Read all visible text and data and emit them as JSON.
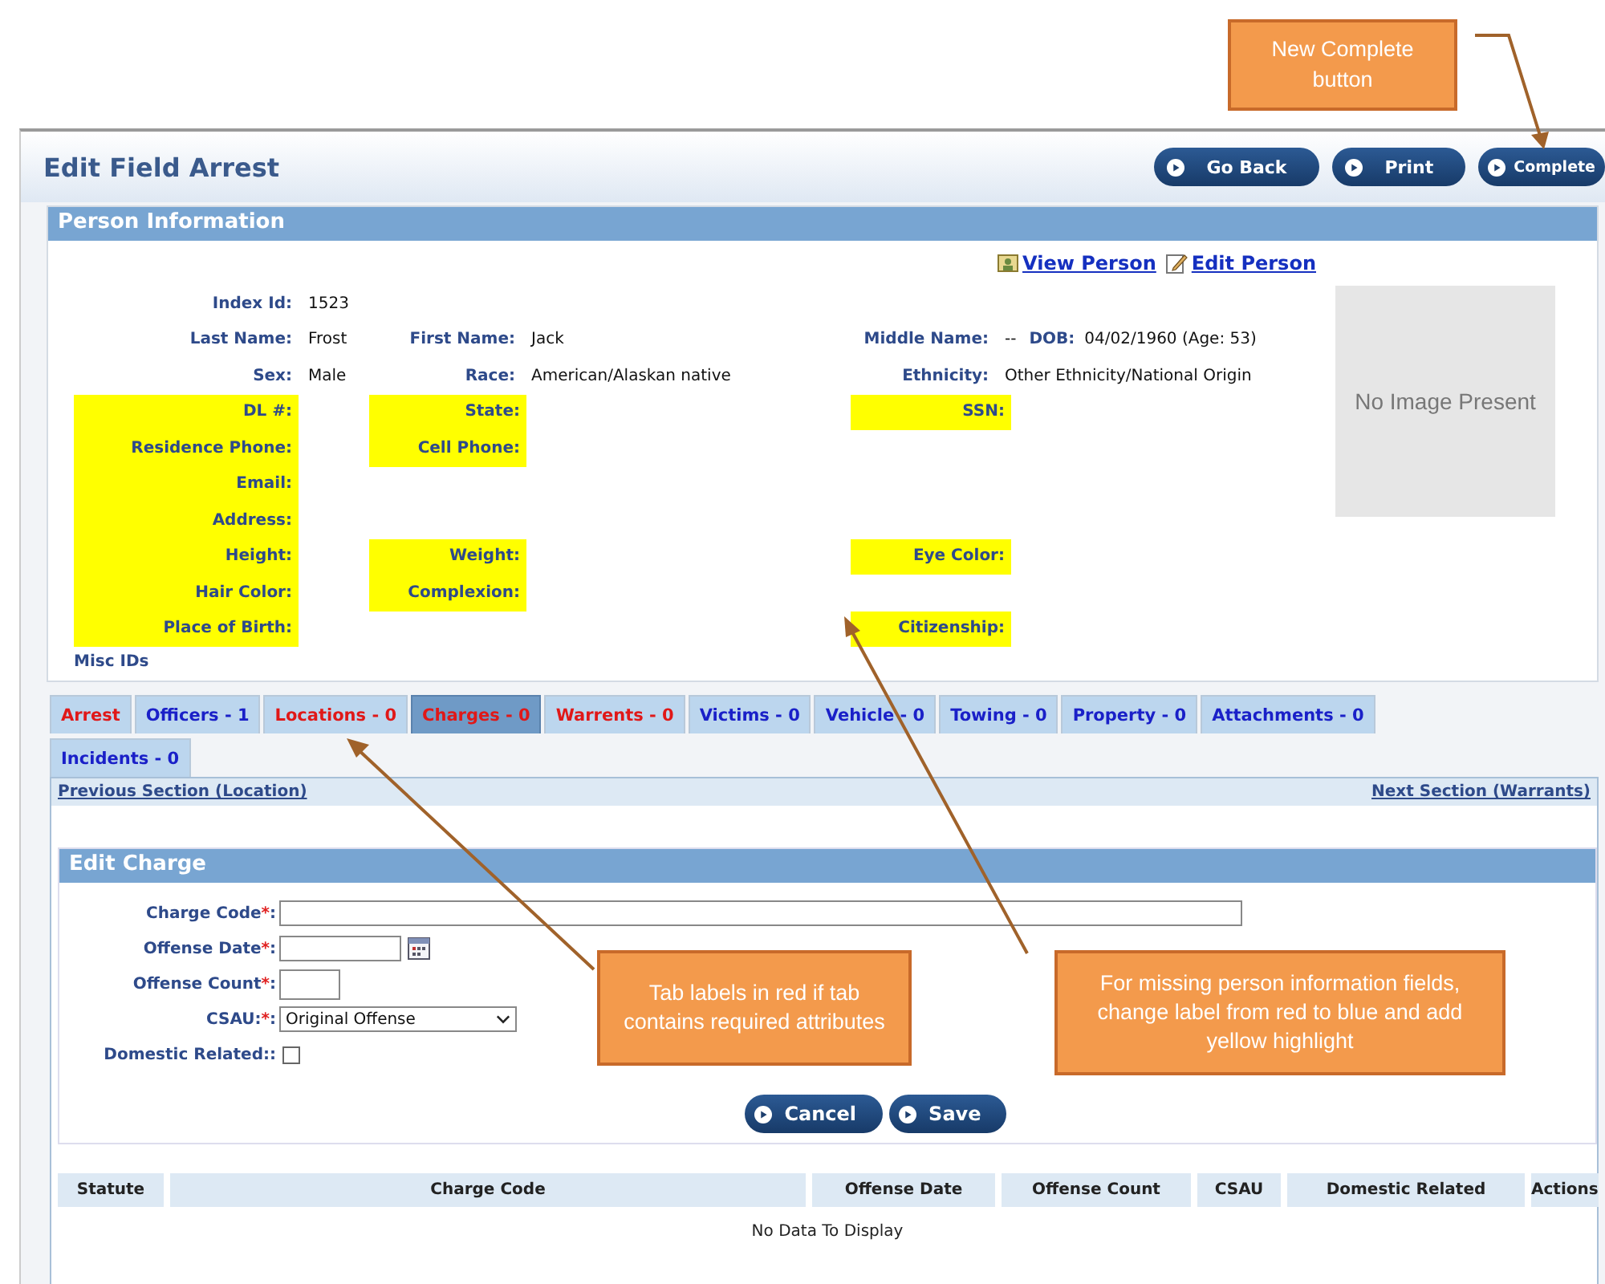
{
  "page_title": "Edit Field Arrest",
  "header_buttons": [
    {
      "label": "Go Back"
    },
    {
      "label": "Print"
    },
    {
      "label": "Complete"
    }
  ],
  "person_info": {
    "title": "Person Information",
    "links": [
      {
        "label": "View Person"
      },
      {
        "label": "Edit Person"
      }
    ],
    "rows": [
      {
        "left": [
          {
            "label": "Index Id:",
            "value": "1523",
            "highlight": false
          }
        ]
      },
      {
        "left": [
          {
            "label": "Last Name:",
            "value": "Frost",
            "highlight": false
          }
        ],
        "middle": [
          {
            "label": "First Name:",
            "value": "Jack",
            "highlight": false
          }
        ],
        "right": [
          {
            "label": "Middle Name:",
            "value": "--",
            "highlight": false
          },
          {
            "label": "DOB:",
            "value": "04/02/1960 (Age: 53)",
            "highlight": false
          }
        ]
      },
      {
        "left": [
          {
            "label": "Sex:",
            "value": "Male",
            "highlight": false
          }
        ],
        "middle": [
          {
            "label": "Race:",
            "value": "American/Alaskan native",
            "highlight": false
          }
        ],
        "right": [
          {
            "label": "Ethnicity:",
            "value": "Other Ethnicity/National Origin",
            "highlight": false
          }
        ]
      },
      {
        "left": [
          {
            "label": "DL #:",
            "highlight": true
          }
        ],
        "middle": [
          {
            "label": "State:",
            "highlight": true
          }
        ],
        "right": [
          {
            "label": "SSN:",
            "highlight": true
          }
        ]
      },
      {
        "left": [
          {
            "label": "Residence Phone:",
            "highlight": true
          }
        ],
        "middle": [
          {
            "label": "Cell Phone:",
            "highlight": true
          }
        ]
      },
      {
        "left": [
          {
            "label": "Email:",
            "highlight": true
          }
        ]
      },
      {
        "left": [
          {
            "label": "Address:",
            "highlight": true
          }
        ]
      },
      {
        "left": [
          {
            "label": "Height:",
            "highlight": true
          }
        ],
        "middle": [
          {
            "label": "Weight:",
            "highlight": true
          }
        ],
        "right": [
          {
            "label": "Eye Color:",
            "highlight": true
          }
        ]
      },
      {
        "left": [
          {
            "label": "Hair Color:",
            "highlight": true
          }
        ],
        "middle": [
          {
            "label": "Complexion:",
            "highlight": true
          }
        ]
      },
      {
        "left": [
          {
            "label": "Place of Birth:",
            "highlight": true
          }
        ],
        "right": [
          {
            "label": "Citizenship:",
            "highlight": true
          }
        ]
      }
    ],
    "misc_ids": "Misc IDs",
    "image_placeholder": "No Image Present"
  },
  "tabs": [
    {
      "label": "Arrest",
      "required": true,
      "selected": false
    },
    {
      "label": "Officers - 1",
      "required": false,
      "selected": false
    },
    {
      "label": "Locations - 0",
      "required": true,
      "selected": false
    },
    {
      "label": "Charges - 0",
      "required": true,
      "selected": true
    },
    {
      "label": "Warrents - 0",
      "required": true,
      "selected": false
    },
    {
      "label": "Victims - 0",
      "required": false,
      "selected": false
    },
    {
      "label": "Vehicle - 0",
      "required": false,
      "selected": false
    },
    {
      "label": "Towing - 0",
      "required": false,
      "selected": false
    },
    {
      "label": "Property - 0",
      "required": false,
      "selected": false
    },
    {
      "label": "Attachments - 0",
      "required": false,
      "selected": false
    },
    {
      "label": "Incidents - 0",
      "required": false,
      "selected": false
    }
  ],
  "section_nav": {
    "previous": "Previous Section (Location)",
    "next": "Next Section (Warrants)"
  },
  "edit_charge": {
    "title": "Edit Charge",
    "fields": [
      {
        "kind": "text",
        "label": "Charge Code",
        "required_mark": "*",
        "label_end": ":"
      },
      {
        "kind": "date",
        "label": "Offense Date",
        "required_mark": "*",
        "label_end": ":"
      },
      {
        "kind": "number",
        "label": "Offense Count",
        "required_mark": "*",
        "label_end": ":"
      },
      {
        "kind": "select",
        "label": "CSAU:",
        "required_mark": "*",
        "label_end": ":",
        "value": "Original Offense"
      },
      {
        "kind": "checkbox",
        "label": "Domestic Related::",
        "checked": false
      }
    ],
    "buttons": [
      {
        "label": "Cancel"
      },
      {
        "label": "Save"
      }
    ]
  },
  "table": {
    "columns": [
      "Statute",
      "Charge Code",
      "Offense Date",
      "Offense Count",
      "CSAU",
      "Domestic Related",
      "Actions"
    ],
    "empty_message": "No Data To Display"
  },
  "callouts": [
    {
      "text": "New Complete button"
    },
    {
      "text": "Tab labels in red if tab contains required attributes"
    },
    {
      "text": "For missing person information fields, change label from red to blue and add yellow highlight"
    }
  ]
}
